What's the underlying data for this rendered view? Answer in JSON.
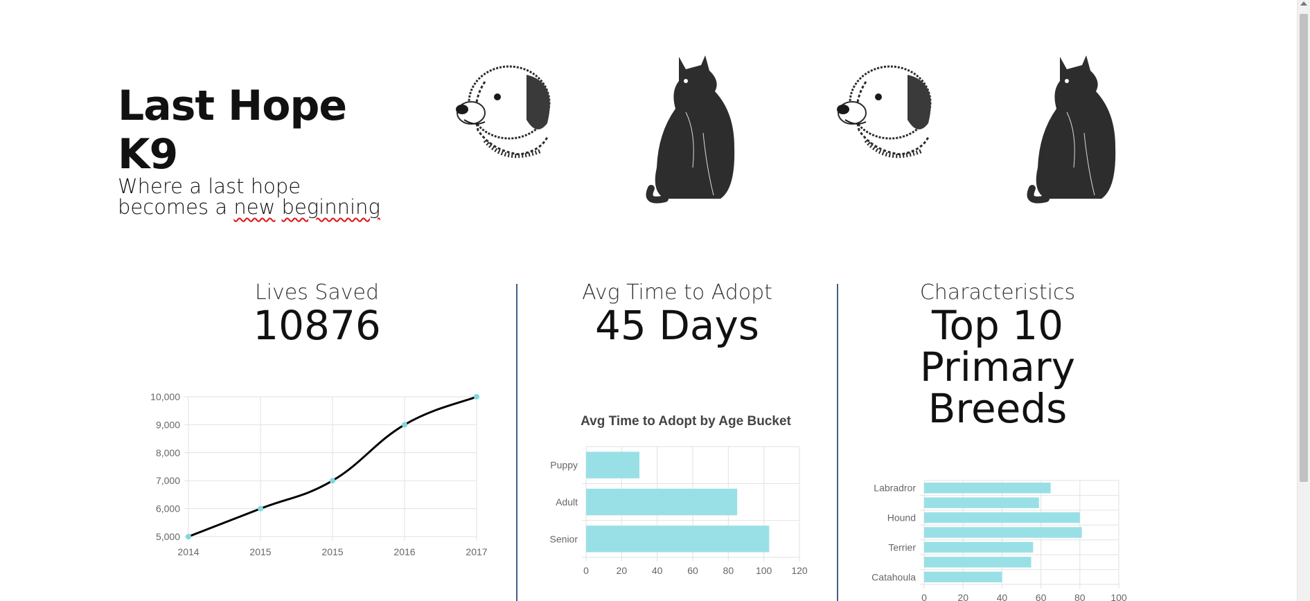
{
  "header": {
    "title": "Last Hope K9",
    "tagline_line1": "Where a last hope",
    "tagline_line2_prefix": "becomes a",
    "tagline_underlined_1": "new",
    "tagline_underlined_2": "beginning"
  },
  "pets": [
    {
      "icon": "dog-sketch-icon"
    },
    {
      "icon": "cat-sketch-icon"
    },
    {
      "icon": "dog-sketch-icon"
    },
    {
      "icon": "cat-sketch-icon"
    }
  ],
  "stats": {
    "lives_saved": {
      "label": "Lives Saved",
      "value": "10876"
    },
    "avg_time": {
      "label": "Avg Time to Adopt",
      "value": "45 Days"
    },
    "characteristics": {
      "label": "Characteristics",
      "value_line1": "Top 10",
      "value_line2": "Primary",
      "value_line3": "Breeds"
    }
  },
  "colors": {
    "bar": "#99e0e6",
    "line": "#000000",
    "point": "#7fd8df",
    "divider": "#3f5f86",
    "grid": "#e2e2e2",
    "tick": "#666666"
  },
  "chart_data": [
    {
      "type": "line",
      "title": "",
      "categories": [
        "2014",
        "2015",
        "2015",
        "2016",
        "2017"
      ],
      "series": [
        {
          "values": [
            5000,
            6000,
            7000,
            9000,
            10000
          ]
        }
      ],
      "ylim": [
        5000,
        10000
      ],
      "yticks": [
        "10,000",
        "9,000",
        "8,000",
        "7,000",
        "6,000",
        "5,000"
      ],
      "grid": true
    },
    {
      "type": "bar",
      "orientation": "horizontal",
      "title": "Avg Time to Adopt by Age Bucket",
      "categories": [
        "Puppy",
        "Adult",
        "Senior"
      ],
      "values": [
        30,
        85,
        103
      ],
      "xlim": [
        0,
        120
      ],
      "xticks": [
        "0",
        "20",
        "40",
        "60",
        "80",
        "100",
        "120"
      ],
      "grid": true
    },
    {
      "type": "bar",
      "orientation": "horizontal",
      "title": "",
      "categories": [
        "Labradror",
        "",
        "Hound",
        "",
        "Terrier",
        "",
        "Catahoula"
      ],
      "values": [
        65,
        59,
        80,
        81,
        56,
        55,
        40
      ],
      "xlim": [
        0,
        100
      ],
      "xticks": [
        "0",
        "20",
        "40",
        "60",
        "80",
        "100"
      ],
      "grid": true
    }
  ]
}
